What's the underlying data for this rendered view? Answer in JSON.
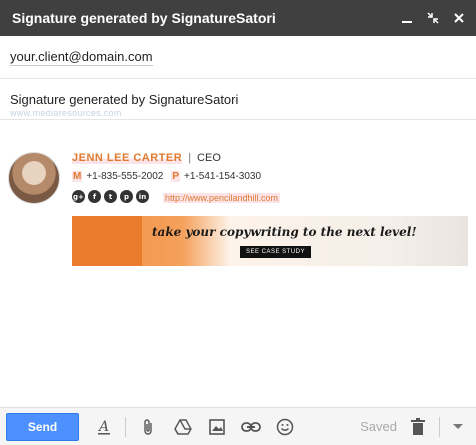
{
  "window": {
    "title": "Signature generated by SignatureSatori",
    "controls": [
      "minimize-icon",
      "expand-icon",
      "close-icon"
    ]
  },
  "compose": {
    "to_value": "your.client@domain.com",
    "subject_value": "Signature generated by SignatureSatori",
    "ghost_text": "www.mediaresources.com"
  },
  "signature": {
    "name": "JENN LEE CARTER",
    "separator": "|",
    "role": "CEO",
    "mobile_key": "M",
    "mobile_value": "+1-835-555-2002",
    "phone_key": "P",
    "phone_value": "+1-541-154-3030",
    "social": [
      {
        "icon": "google-plus-icon",
        "glyph": "g+"
      },
      {
        "icon": "facebook-icon",
        "glyph": "f"
      },
      {
        "icon": "twitter-icon",
        "glyph": "t"
      },
      {
        "icon": "pinterest-icon",
        "glyph": "p"
      },
      {
        "icon": "linkedin-icon",
        "glyph": "in"
      }
    ],
    "url": "http://www.pencilandhill.com",
    "banner": {
      "tagline": "take your copywriting to the next level!",
      "cta": "SEE CASE STUDY"
    }
  },
  "toolbar": {
    "send_label": "Send",
    "saved_label": "Saved",
    "icons": [
      "formatting-icon",
      "attach-icon",
      "drive-icon",
      "insert-photo-icon",
      "link-icon",
      "emoji-icon",
      "trash-icon",
      "more-options-icon"
    ]
  },
  "colors": {
    "titlebar": "#404040",
    "send": "#4d90fe",
    "accent": "#e07a2f",
    "highlight": "#fbe3e8"
  }
}
